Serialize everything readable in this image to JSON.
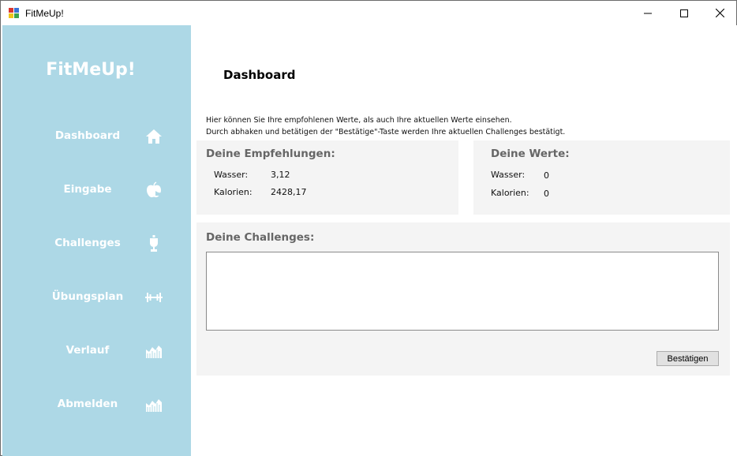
{
  "window": {
    "title": "FitMeUp!"
  },
  "sidebar": {
    "brand": "FitMeUp!",
    "items": [
      {
        "label": "Dashboard",
        "icon": "home-icon"
      },
      {
        "label": "Eingabe",
        "icon": "apple-icon"
      },
      {
        "label": "Challenges",
        "icon": "trophy-icon"
      },
      {
        "label": "Übungsplan",
        "icon": "dumbbell-icon"
      },
      {
        "label": "Verlauf",
        "icon": "area-chart-icon"
      },
      {
        "label": "Abmelden",
        "icon": "area-chart-icon"
      }
    ],
    "background_color": "#add8e6"
  },
  "main": {
    "title": "Dashboard",
    "description_line1": "Hier können Sie Ihre empfohlenen Werte, als auch Ihre aktuellen Werte einsehen.",
    "description_line2": "Durch abhaken und betätigen der \"Bestätige\"-Taste werden Ihre aktuellen Challenges bestätigt.",
    "recommendations": {
      "title": "Deine Empfehlungen:",
      "water_label": "Wasser:",
      "water_value": "3,12",
      "calories_label": "Kalorien:",
      "calories_value": "2428,17"
    },
    "values": {
      "title": "Deine Werte:",
      "water_label": "Wasser:",
      "water_value": "0",
      "calories_label": "Kalorien:",
      "calories_value": "0"
    },
    "challenges": {
      "title": "Deine Challenges:",
      "confirm_label": "Bestätigen"
    }
  }
}
